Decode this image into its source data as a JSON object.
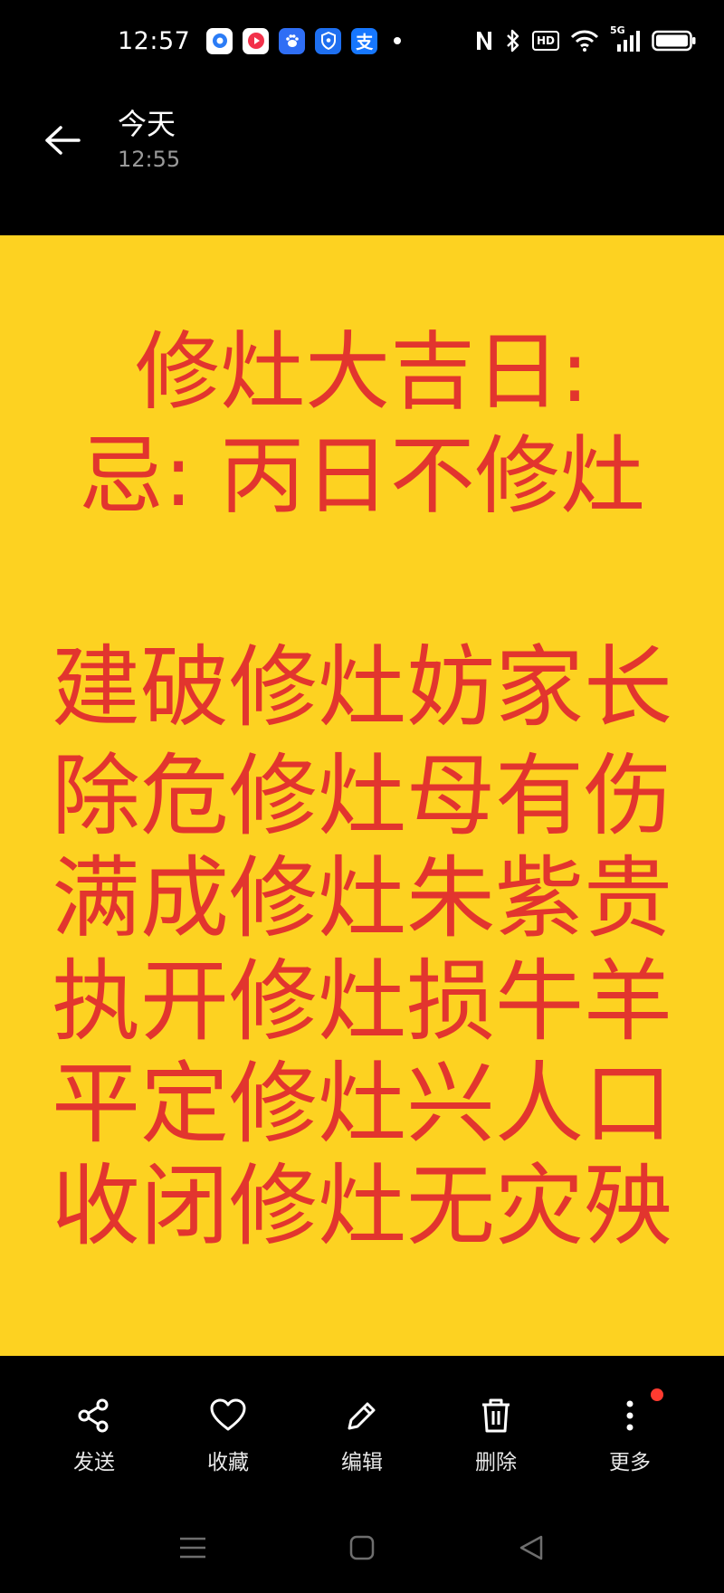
{
  "status_bar": {
    "time": "12:57",
    "network_label": "5G",
    "hd_label": "HD",
    "app_icons": [
      "browser-icon",
      "video-icon",
      "baidu-icon",
      "shield-icon",
      "alipay-icon"
    ],
    "alipay_glyph": "支"
  },
  "header": {
    "title": "今天",
    "subtitle": "12:55"
  },
  "image": {
    "background": "#fdd221",
    "text_color": "#e2352e",
    "heading_line1": "修灶大吉日:",
    "heading_line2": "忌: 丙日不修灶",
    "lines": [
      "建破修灶妨家长",
      "除危修灶母有伤",
      "满成修灶朱紫贵",
      "执开修灶损牛羊",
      "平定修灶兴人口",
      "收闭修灶无灾殃"
    ]
  },
  "toolbar": {
    "send_label": "发送",
    "favorite_label": "收藏",
    "edit_label": "编辑",
    "delete_label": "删除",
    "more_label": "更多"
  }
}
